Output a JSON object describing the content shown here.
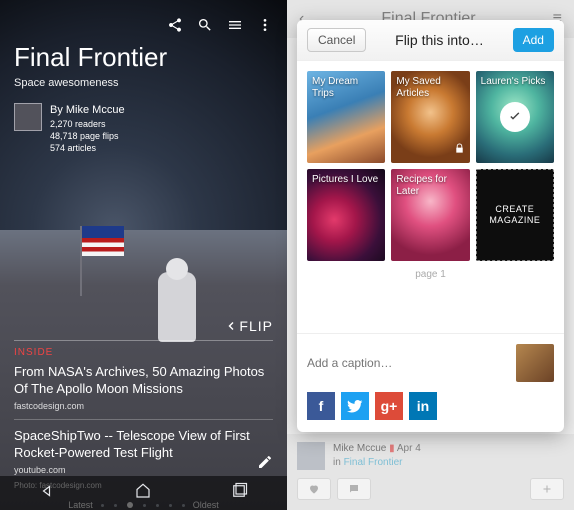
{
  "left": {
    "title": "Final Frontier",
    "subtitle": "Space awesomeness",
    "author": {
      "by": "By Mike Mccue",
      "readers": "2,270 readers",
      "flips": "48,718 page flips",
      "articles": "574 articles"
    },
    "flip_label": "FLIP",
    "inside_label": "INSIDE",
    "articles": [
      {
        "title": "From NASA's Archives, 50 Amazing Photos Of The Apollo Moon Missions",
        "source": "fastcodesign.com"
      },
      {
        "title": "SpaceShipTwo -- Telescope View of First Rocket-Powered Test Flight",
        "source": "youtube.com"
      }
    ],
    "photo_credit": "Photo: fastcodesign.com",
    "timeline": {
      "latest": "Latest",
      "oldest": "Oldest"
    }
  },
  "right": {
    "dim": {
      "header": "Final Frontier",
      "user": "Mike Mccue",
      "date": "Apr 4",
      "in": "in",
      "source": "Final Frontier"
    },
    "modal": {
      "cancel": "Cancel",
      "title": "Flip this into…",
      "add": "Add",
      "magazines": [
        {
          "label": "My Dream Trips"
        },
        {
          "label": "My Saved Articles",
          "locked": true
        },
        {
          "label": "Lauren's Picks",
          "selected": true
        },
        {
          "label": "Pictures I Love"
        },
        {
          "label": "Recipes for Later"
        }
      ],
      "create_label": "CREATE MAGAZINE",
      "pager": "page 1",
      "caption_placeholder": "Add a caption…"
    }
  }
}
